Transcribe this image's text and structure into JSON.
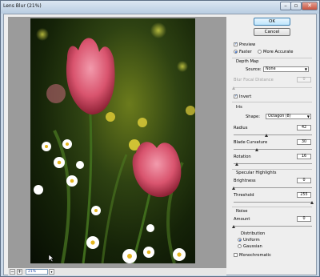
{
  "window": {
    "title": "Lens Blur (21%)"
  },
  "buttons": {
    "ok": "OK",
    "cancel": "Cancel"
  },
  "preview": {
    "label": "Preview",
    "checked": true,
    "faster": "Faster",
    "more_accurate": "More Accurate"
  },
  "depth_map": {
    "heading": "Depth Map",
    "source_label": "Source:",
    "source_value": "None",
    "blur_focal_label": "Blur Focal Distance",
    "blur_focal_value": "0",
    "invert_label": "Invert"
  },
  "iris": {
    "heading": "Iris",
    "shape_label": "Shape:",
    "shape_value": "Octagon (8)",
    "radius_label": "Radius",
    "radius_value": "42",
    "radius_fraction": 0.42,
    "blade_label": "Blade Curvature",
    "blade_value": "30",
    "blade_fraction": 0.3,
    "rotation_label": "Rotation",
    "rotation_value": "16",
    "rotation_fraction": 0.044
  },
  "specular": {
    "heading": "Specular Highlights",
    "brightness_label": "Brightness",
    "brightness_value": "0",
    "brightness_fraction": 0,
    "threshold_label": "Threshold",
    "threshold_value": "255",
    "threshold_fraction": 1
  },
  "noise": {
    "heading": "Noise",
    "amount_label": "Amount",
    "amount_value": "0",
    "amount_fraction": 0,
    "distribution_heading": "Distribution",
    "uniform": "Uniform",
    "gaussian": "Gaussian",
    "monochromatic": "Monochromatic"
  },
  "status": {
    "zoom": "21%",
    "minus": "−",
    "plus": "+"
  },
  "colors": {
    "accent": "#2a63c7",
    "petal": "#d9546e",
    "title_bar": "#c9d8e8"
  }
}
